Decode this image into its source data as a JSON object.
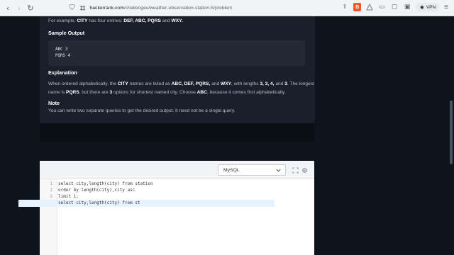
{
  "browser": {
    "url_host": "hackerrank.com",
    "url_path": "/challenges/weather-observation-station-5/problem",
    "vpn_label": "VPN"
  },
  "problem": {
    "example_prefix": "For example,",
    "example_city": "CITY",
    "example_mid": "has four entries:",
    "example_entries": "DEF, ABC, PQRS",
    "example_and": "and",
    "example_last": "WXY.",
    "sample_output_heading": "Sample Output",
    "sample_output_lines": [
      "ABC 3",
      "PQRS 4"
    ],
    "explanation_heading": "Explanation",
    "explanation_line1_a": "When ordered alphabetically, the",
    "explanation_line1_city": "CITY",
    "explanation_line1_b": "names are listed as",
    "explanation_line1_list": "ABC, DEF, PQRS,",
    "explanation_line1_and": "and",
    "explanation_line1_wxy": "WXY",
    "explanation_line1_c": ", with lengths",
    "explanation_line1_lengths": "3, 3, 4,",
    "explanation_line1_and2": "and",
    "explanation_line1_last": "3",
    "explanation_line1_end": ". The longest",
    "explanation_line2_a": "name is",
    "explanation_line2_pqrs": "PQRS",
    "explanation_line2_b": ", but there are",
    "explanation_line2_count": "3",
    "explanation_line2_c": "options for shortest named city. Choose",
    "explanation_line2_abc": "ABC",
    "explanation_line2_end": ", because it comes first alphabetically.",
    "note_heading": "Note",
    "note_text": "You can write two separate queries to get the desired output. It need not be a single query."
  },
  "editor": {
    "language": "MySQL",
    "line_numbers": [
      "1",
      "2",
      "3",
      "4"
    ],
    "lines": [
      "select city,length(city) from station",
      "order by length(city),city asc",
      "limit 1;",
      "select city,length(city) from st"
    ]
  },
  "colors": {
    "page_bg": "#0e141e",
    "panel_bg": "#1a1f2b",
    "editor_bg": "#ffffff"
  }
}
